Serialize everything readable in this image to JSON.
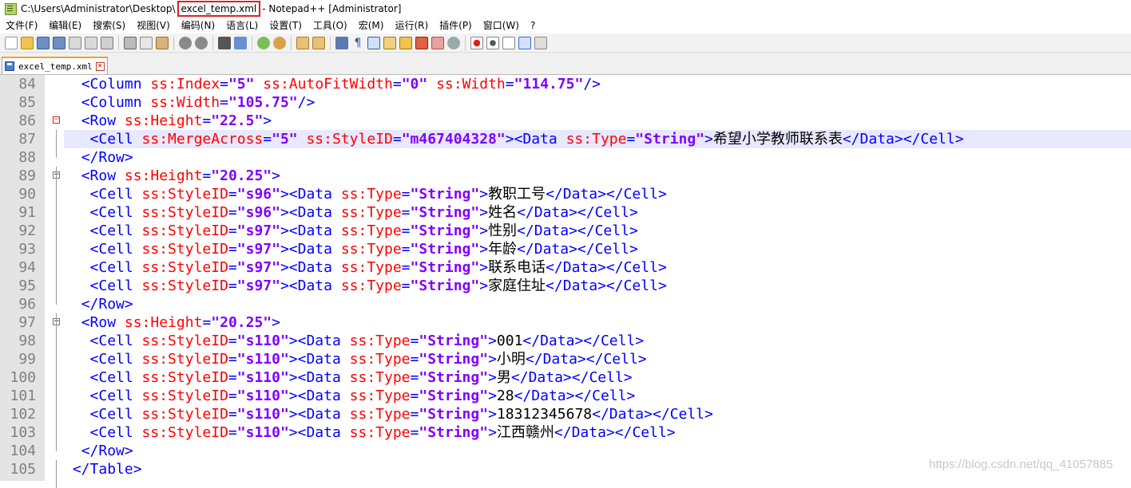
{
  "window": {
    "title_prefix": "C:\\Users\\Administrator\\Desktop\\",
    "file_name": "excel_temp.xml",
    "title_suffix": "- Notepad++ [Administrator]"
  },
  "menu": [
    "文件(F)",
    "编辑(E)",
    "搜索(S)",
    "视图(V)",
    "编码(N)",
    "语言(L)",
    "设置(T)",
    "工具(O)",
    "宏(M)",
    "运行(R)",
    "插件(P)",
    "窗口(W)",
    "?"
  ],
  "tab": {
    "label": "excel_temp.xml"
  },
  "editor": {
    "lines": [
      {
        "num": "84",
        "indent": "  ",
        "code": [
          {
            "c": "t",
            "s": "<Column "
          },
          {
            "c": "a",
            "s": "ss:Index"
          },
          {
            "c": "t",
            "s": "="
          },
          {
            "c": "v",
            "s": "\"5\""
          },
          {
            "c": "t",
            "s": " "
          },
          {
            "c": "a",
            "s": "ss:AutoFitWidth"
          },
          {
            "c": "t",
            "s": "="
          },
          {
            "c": "v",
            "s": "\"0\""
          },
          {
            "c": "t",
            "s": " "
          },
          {
            "c": "a",
            "s": "ss:Width"
          },
          {
            "c": "t",
            "s": "="
          },
          {
            "c": "v",
            "s": "\"114.75\""
          },
          {
            "c": "t",
            "s": "/>"
          }
        ]
      },
      {
        "num": "85",
        "indent": "  ",
        "code": [
          {
            "c": "t",
            "s": "<Column "
          },
          {
            "c": "a",
            "s": "ss:Width"
          },
          {
            "c": "t",
            "s": "="
          },
          {
            "c": "v",
            "s": "\"105.75\""
          },
          {
            "c": "t",
            "s": "/>"
          }
        ]
      },
      {
        "num": "86",
        "indent": "  ",
        "fold": "red",
        "code": [
          {
            "c": "t",
            "s": "<Row "
          },
          {
            "c": "a",
            "s": "ss:Height"
          },
          {
            "c": "t",
            "s": "="
          },
          {
            "c": "v",
            "s": "\"22.5\""
          },
          {
            "c": "t",
            "s": ">"
          }
        ]
      },
      {
        "num": "87",
        "indent": "   ",
        "highlight": true,
        "code": [
          {
            "c": "t",
            "s": "<Cell "
          },
          {
            "c": "a",
            "s": "ss:MergeAcross"
          },
          {
            "c": "t",
            "s": "="
          },
          {
            "c": "v",
            "s": "\"5\""
          },
          {
            "c": "t",
            "s": " "
          },
          {
            "c": "a",
            "s": "ss:StyleID"
          },
          {
            "c": "t",
            "s": "="
          },
          {
            "c": "v",
            "s": "\"m467404328\""
          },
          {
            "c": "t",
            "s": "><Data "
          },
          {
            "c": "a",
            "s": "ss:Type"
          },
          {
            "c": "t",
            "s": "="
          },
          {
            "c": "v",
            "s": "\"String\""
          },
          {
            "c": "t",
            "s": ">"
          },
          {
            "c": "x",
            "s": "希望小学教师联系表"
          },
          {
            "c": "t",
            "s": "</Data></Cell>"
          }
        ]
      },
      {
        "num": "88",
        "indent": "  ",
        "code": [
          {
            "c": "t",
            "s": "</Row>"
          }
        ]
      },
      {
        "num": "89",
        "indent": "  ",
        "fold": "gray",
        "code": [
          {
            "c": "t",
            "s": "<Row "
          },
          {
            "c": "a",
            "s": "ss:Height"
          },
          {
            "c": "t",
            "s": "="
          },
          {
            "c": "v",
            "s": "\"20.25\""
          },
          {
            "c": "t",
            "s": ">"
          }
        ]
      },
      {
        "num": "90",
        "indent": "   ",
        "code": [
          {
            "c": "t",
            "s": "<Cell "
          },
          {
            "c": "a",
            "s": "ss:StyleID"
          },
          {
            "c": "t",
            "s": "="
          },
          {
            "c": "v",
            "s": "\"s96\""
          },
          {
            "c": "t",
            "s": "><Data "
          },
          {
            "c": "a",
            "s": "ss:Type"
          },
          {
            "c": "t",
            "s": "="
          },
          {
            "c": "v",
            "s": "\"String\""
          },
          {
            "c": "t",
            "s": ">"
          },
          {
            "c": "x",
            "s": "教职工号"
          },
          {
            "c": "t",
            "s": "</Data></Cell>"
          }
        ]
      },
      {
        "num": "91",
        "indent": "   ",
        "code": [
          {
            "c": "t",
            "s": "<Cell "
          },
          {
            "c": "a",
            "s": "ss:StyleID"
          },
          {
            "c": "t",
            "s": "="
          },
          {
            "c": "v",
            "s": "\"s96\""
          },
          {
            "c": "t",
            "s": "><Data "
          },
          {
            "c": "a",
            "s": "ss:Type"
          },
          {
            "c": "t",
            "s": "="
          },
          {
            "c": "v",
            "s": "\"String\""
          },
          {
            "c": "t",
            "s": ">"
          },
          {
            "c": "x",
            "s": "姓名"
          },
          {
            "c": "t",
            "s": "</Data></Cell>"
          }
        ]
      },
      {
        "num": "92",
        "indent": "   ",
        "code": [
          {
            "c": "t",
            "s": "<Cell "
          },
          {
            "c": "a",
            "s": "ss:StyleID"
          },
          {
            "c": "t",
            "s": "="
          },
          {
            "c": "v",
            "s": "\"s97\""
          },
          {
            "c": "t",
            "s": "><Data "
          },
          {
            "c": "a",
            "s": "ss:Type"
          },
          {
            "c": "t",
            "s": "="
          },
          {
            "c": "v",
            "s": "\"String\""
          },
          {
            "c": "t",
            "s": ">"
          },
          {
            "c": "x",
            "s": "性别"
          },
          {
            "c": "t",
            "s": "</Data></Cell>"
          }
        ]
      },
      {
        "num": "93",
        "indent": "   ",
        "code": [
          {
            "c": "t",
            "s": "<Cell "
          },
          {
            "c": "a",
            "s": "ss:StyleID"
          },
          {
            "c": "t",
            "s": "="
          },
          {
            "c": "v",
            "s": "\"s97\""
          },
          {
            "c": "t",
            "s": "><Data "
          },
          {
            "c": "a",
            "s": "ss:Type"
          },
          {
            "c": "t",
            "s": "="
          },
          {
            "c": "v",
            "s": "\"String\""
          },
          {
            "c": "t",
            "s": ">"
          },
          {
            "c": "x",
            "s": "年龄"
          },
          {
            "c": "t",
            "s": "</Data></Cell>"
          }
        ]
      },
      {
        "num": "94",
        "indent": "   ",
        "code": [
          {
            "c": "t",
            "s": "<Cell "
          },
          {
            "c": "a",
            "s": "ss:StyleID"
          },
          {
            "c": "t",
            "s": "="
          },
          {
            "c": "v",
            "s": "\"s97\""
          },
          {
            "c": "t",
            "s": "><Data "
          },
          {
            "c": "a",
            "s": "ss:Type"
          },
          {
            "c": "t",
            "s": "="
          },
          {
            "c": "v",
            "s": "\"String\""
          },
          {
            "c": "t",
            "s": ">"
          },
          {
            "c": "x",
            "s": "联系电话"
          },
          {
            "c": "t",
            "s": "</Data></Cell>"
          }
        ]
      },
      {
        "num": "95",
        "indent": "   ",
        "code": [
          {
            "c": "t",
            "s": "<Cell "
          },
          {
            "c": "a",
            "s": "ss:StyleID"
          },
          {
            "c": "t",
            "s": "="
          },
          {
            "c": "v",
            "s": "\"s97\""
          },
          {
            "c": "t",
            "s": "><Data "
          },
          {
            "c": "a",
            "s": "ss:Type"
          },
          {
            "c": "t",
            "s": "="
          },
          {
            "c": "v",
            "s": "\"String\""
          },
          {
            "c": "t",
            "s": ">"
          },
          {
            "c": "x",
            "s": "家庭住址"
          },
          {
            "c": "t",
            "s": "</Data></Cell>"
          }
        ]
      },
      {
        "num": "96",
        "indent": "  ",
        "code": [
          {
            "c": "t",
            "s": "</Row>"
          }
        ]
      },
      {
        "num": "97",
        "indent": "  ",
        "fold": "gray",
        "code": [
          {
            "c": "t",
            "s": "<Row "
          },
          {
            "c": "a",
            "s": "ss:Height"
          },
          {
            "c": "t",
            "s": "="
          },
          {
            "c": "v",
            "s": "\"20.25\""
          },
          {
            "c": "t",
            "s": ">"
          }
        ]
      },
      {
        "num": "98",
        "indent": "   ",
        "code": [
          {
            "c": "t",
            "s": "<Cell "
          },
          {
            "c": "a",
            "s": "ss:StyleID"
          },
          {
            "c": "t",
            "s": "="
          },
          {
            "c": "v",
            "s": "\"s110\""
          },
          {
            "c": "t",
            "s": "><Data "
          },
          {
            "c": "a",
            "s": "ss:Type"
          },
          {
            "c": "t",
            "s": "="
          },
          {
            "c": "v",
            "s": "\"String\""
          },
          {
            "c": "t",
            "s": ">"
          },
          {
            "c": "x",
            "s": "001"
          },
          {
            "c": "t",
            "s": "</Data></Cell>"
          }
        ]
      },
      {
        "num": "99",
        "indent": "   ",
        "code": [
          {
            "c": "t",
            "s": "<Cell "
          },
          {
            "c": "a",
            "s": "ss:StyleID"
          },
          {
            "c": "t",
            "s": "="
          },
          {
            "c": "v",
            "s": "\"s110\""
          },
          {
            "c": "t",
            "s": "><Data "
          },
          {
            "c": "a",
            "s": "ss:Type"
          },
          {
            "c": "t",
            "s": "="
          },
          {
            "c": "v",
            "s": "\"String\""
          },
          {
            "c": "t",
            "s": ">"
          },
          {
            "c": "x",
            "s": "小明"
          },
          {
            "c": "t",
            "s": "</Data></Cell>"
          }
        ]
      },
      {
        "num": "100",
        "indent": "   ",
        "code": [
          {
            "c": "t",
            "s": "<Cell "
          },
          {
            "c": "a",
            "s": "ss:StyleID"
          },
          {
            "c": "t",
            "s": "="
          },
          {
            "c": "v",
            "s": "\"s110\""
          },
          {
            "c": "t",
            "s": "><Data "
          },
          {
            "c": "a",
            "s": "ss:Type"
          },
          {
            "c": "t",
            "s": "="
          },
          {
            "c": "v",
            "s": "\"String\""
          },
          {
            "c": "t",
            "s": ">"
          },
          {
            "c": "x",
            "s": "男"
          },
          {
            "c": "t",
            "s": "</Data></Cell>"
          }
        ]
      },
      {
        "num": "101",
        "indent": "   ",
        "code": [
          {
            "c": "t",
            "s": "<Cell "
          },
          {
            "c": "a",
            "s": "ss:StyleID"
          },
          {
            "c": "t",
            "s": "="
          },
          {
            "c": "v",
            "s": "\"s110\""
          },
          {
            "c": "t",
            "s": "><Data "
          },
          {
            "c": "a",
            "s": "ss:Type"
          },
          {
            "c": "t",
            "s": "="
          },
          {
            "c": "v",
            "s": "\"String\""
          },
          {
            "c": "t",
            "s": ">"
          },
          {
            "c": "x",
            "s": "28"
          },
          {
            "c": "t",
            "s": "</Data></Cell>"
          }
        ]
      },
      {
        "num": "102",
        "indent": "   ",
        "code": [
          {
            "c": "t",
            "s": "<Cell "
          },
          {
            "c": "a",
            "s": "ss:StyleID"
          },
          {
            "c": "t",
            "s": "="
          },
          {
            "c": "v",
            "s": "\"s110\""
          },
          {
            "c": "t",
            "s": "><Data "
          },
          {
            "c": "a",
            "s": "ss:Type"
          },
          {
            "c": "t",
            "s": "="
          },
          {
            "c": "v",
            "s": "\"String\""
          },
          {
            "c": "t",
            "s": ">"
          },
          {
            "c": "x",
            "s": "18312345678"
          },
          {
            "c": "t",
            "s": "</Data></Cell>"
          }
        ]
      },
      {
        "num": "103",
        "indent": "   ",
        "code": [
          {
            "c": "t",
            "s": "<Cell "
          },
          {
            "c": "a",
            "s": "ss:StyleID"
          },
          {
            "c": "t",
            "s": "="
          },
          {
            "c": "v",
            "s": "\"s110\""
          },
          {
            "c": "t",
            "s": "><Data "
          },
          {
            "c": "a",
            "s": "ss:Type"
          },
          {
            "c": "t",
            "s": "="
          },
          {
            "c": "v",
            "s": "\"String\""
          },
          {
            "c": "t",
            "s": ">"
          },
          {
            "c": "x",
            "s": "江西赣州"
          },
          {
            "c": "t",
            "s": "</Data></Cell>"
          }
        ]
      },
      {
        "num": "104",
        "indent": "  ",
        "code": [
          {
            "c": "t",
            "s": "</Row>"
          }
        ]
      },
      {
        "num": "105",
        "indent": " ",
        "code": [
          {
            "c": "t",
            "s": "</Table>"
          }
        ]
      }
    ]
  },
  "watermark": "https://blog.csdn.net/qq_41057885",
  "colors": {
    "tag": "#0000ff",
    "attribute": "#ff0000",
    "value": "#8000ff",
    "text": "#000000",
    "current_line": "#e8e8ff",
    "title_highlight": "#e02020"
  }
}
